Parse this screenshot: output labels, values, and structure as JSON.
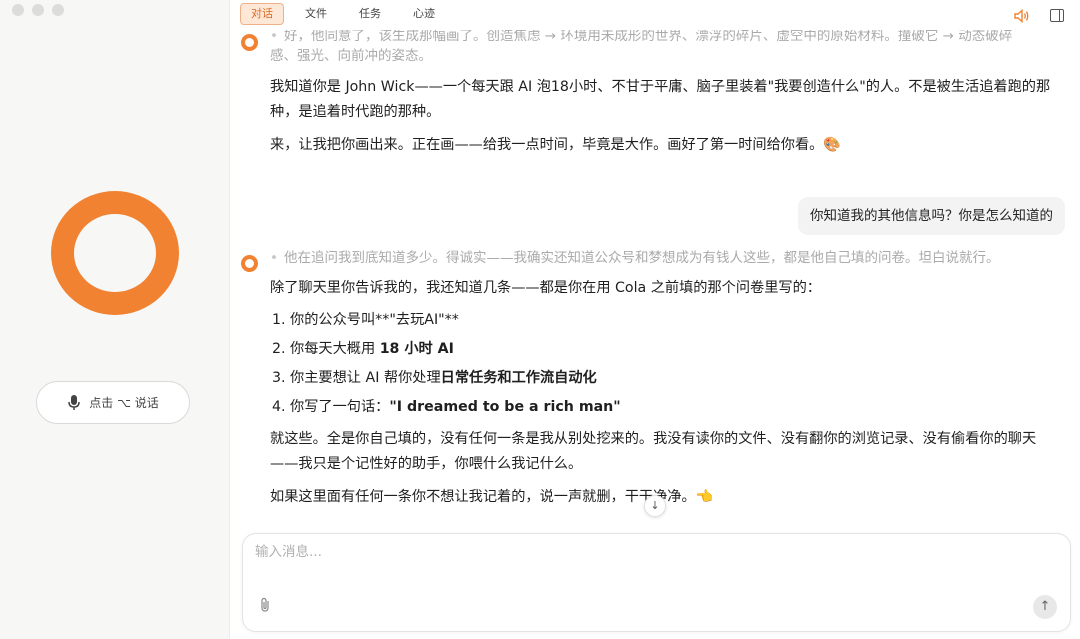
{
  "tabs": [
    {
      "label": "对话",
      "active": true
    },
    {
      "label": "文件",
      "active": false
    },
    {
      "label": "任务",
      "active": false
    },
    {
      "label": "心迹",
      "active": false
    }
  ],
  "accent_color": "#f08232",
  "sidebar": {
    "talk_button_label": "点击 ⌥ 说话"
  },
  "messages": {
    "thinking1_line1": "好，他同意了，该生成那幅画了。创造焦虑 → 环境用未成形的世界、漂浮的碎片、虚空中的原始材料。撞破它 → 动态破碎",
    "thinking1_line2": "感、强光、向前冲的姿态。",
    "reply1_p1": "我知道你是 John Wick——一个每天跟 AI 泡18小时、不甘于平庸、脑子里装着\"我要创造什么\"的人。不是被生活追着跑的那种，是追着时代跑的那种。",
    "reply1_p2": "来，让我把你画出来。正在画——给我一点时间，毕竟是大作。画好了第一时间给你看。🎨",
    "user_question": "你知道我的其他信息吗？你是怎么知道的",
    "thinking2": "他在追问我到底知道多少。得诚实——我确实还知道公众号和梦想成为有钱人这些，都是他自己填的问卷。坦白说就行。",
    "reply2_intro": "除了聊天里你告诉我的，我还知道几条——都是你在用 Cola 之前填的那个问卷里写的：",
    "list": [
      {
        "prefix": "1. 你的公众号叫**\"去玩AI\"**",
        "bold": ""
      },
      {
        "prefix": "2. 你每天大概用 ",
        "bold": "18 小时 AI"
      },
      {
        "prefix": "3. 你主要想让 AI 帮你处理",
        "bold": "日常任务和工作流自动化"
      },
      {
        "prefix": "4. 你写了一句话：",
        "bold": "\"I dreamed to be a rich man\""
      }
    ],
    "reply2_p2": "就这些。全是你自己填的，没有任何一条是我从别处挖来的。我没有读你的文件、没有翻你的浏览记录、没有偷看你的聊天——我只是个记性好的助手，你喂什么我记什么。",
    "reply2_p3": "如果这里面有任何一条你不想让我记着的，说一声就删，干干净净。👈"
  },
  "composer": {
    "placeholder": "输入消息..."
  }
}
